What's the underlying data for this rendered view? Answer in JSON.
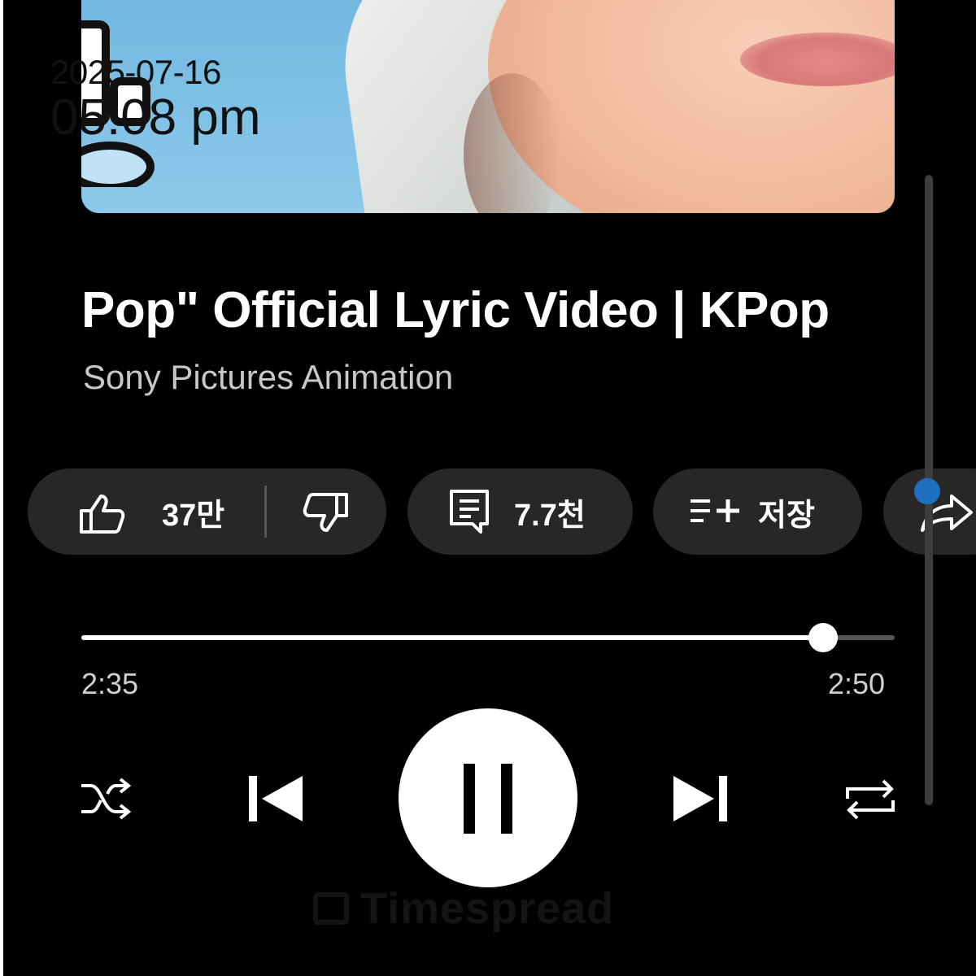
{
  "overlay": {
    "date": "2025-07-16",
    "time": "05:08 pm"
  },
  "video": {
    "title": "Pop\" Official Lyric Video | KPop",
    "channel": "Sony Pictures Animation"
  },
  "actions": {
    "like_count": "37만",
    "comment_count": "7.7천",
    "save_label": "저장"
  },
  "player": {
    "elapsed": "2:35",
    "total": "2:50",
    "progress_fraction": 0.912
  },
  "watermark": "Timespread",
  "colors": {
    "background": "#000000",
    "chip": "#272727",
    "accent_dot": "#1f6fbf"
  },
  "icons": [
    "like-icon",
    "dislike-icon",
    "comment-icon",
    "save-playlist-icon",
    "share-icon",
    "shuffle-icon",
    "previous-icon",
    "pause-icon",
    "next-icon",
    "repeat-icon"
  ]
}
